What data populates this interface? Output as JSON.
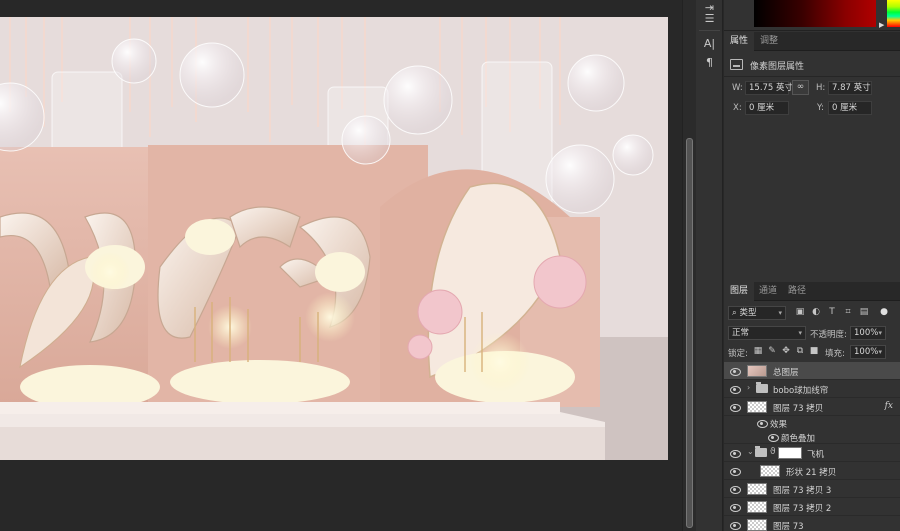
{
  "properties_panel": {
    "tabs": [
      {
        "label": "属性",
        "active": true
      },
      {
        "label": "调整",
        "active": false
      }
    ],
    "header": "像素图层属性",
    "w_label": "W:",
    "w_value": "15.75 英寸",
    "h_label": "H:",
    "h_value": "7.87 英寸",
    "x_label": "X:",
    "x_value": "0 厘米",
    "y_label": "Y:",
    "y_value": "0 厘米"
  },
  "layers_panel": {
    "tabs": [
      {
        "label": "图层",
        "active": true
      },
      {
        "label": "通道",
        "active": false
      },
      {
        "label": "路径",
        "active": false
      }
    ],
    "filter_kind": "类型",
    "blend_mode": "正常",
    "opacity_label": "不透明度:",
    "opacity_value": "100%",
    "lock_label": "锁定:",
    "fill_label": "填充:",
    "fill_value": "100%",
    "layers": [
      {
        "name": "总图层",
        "kind": "pixel-photo",
        "selected": true
      },
      {
        "name": "bobo球加线帘",
        "kind": "group"
      },
      {
        "name": "图层 73 拷贝",
        "kind": "pixel",
        "fx": "fx"
      },
      {
        "name": "效果",
        "kind": "effects-header"
      },
      {
        "name": "颜色叠加",
        "kind": "effect"
      },
      {
        "name": "飞机",
        "kind": "group-mask"
      },
      {
        "name": "形状 21 拷贝",
        "kind": "pixel-child"
      },
      {
        "name": "图层 73 拷贝 3",
        "kind": "pixel"
      },
      {
        "name": "图层 73 拷贝 2",
        "kind": "pixel"
      },
      {
        "name": "图层 73",
        "kind": "pixel"
      }
    ]
  },
  "icons": {
    "strip": [
      "move-tool-icon",
      "sliders-icon",
      "character-icon",
      "paragraph-icon"
    ],
    "filter": [
      "image-filter-icon",
      "adjust-filter-icon",
      "type-filter-icon",
      "shape-filter-icon",
      "smart-filter-icon",
      "toggle-filter-icon"
    ]
  },
  "strip_glyphs": [
    "⇥",
    "☰",
    "A|",
    "¶"
  ],
  "colors": {
    "panel_bg": "#323232",
    "workspace_bg": "#282828",
    "selected_row": "#4a4a4a"
  }
}
